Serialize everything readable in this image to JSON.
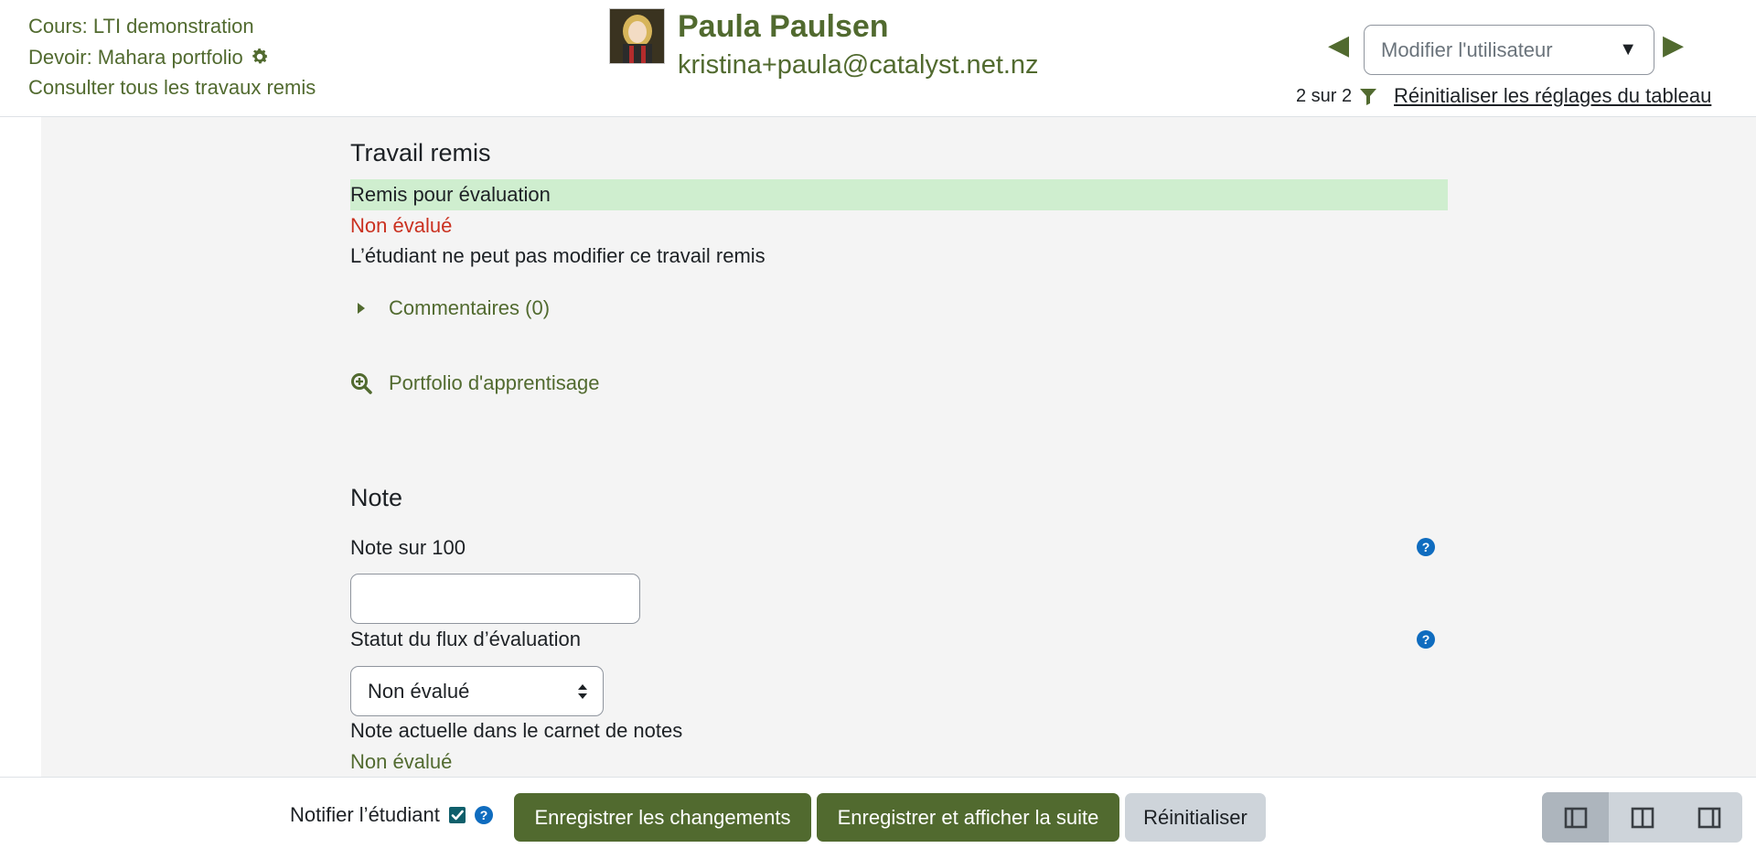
{
  "header": {
    "course": "Cours: LTI demonstration",
    "assignment": "Devoir: Mahara portfolio",
    "view_all": "Consulter tous les travaux remis",
    "user_name": "Paula Paulsen",
    "user_email": "kristina+paula@catalyst.net.nz",
    "change_user_placeholder": "Modifier l'utilisateur",
    "prev_symbol": "◀",
    "next_symbol": "▶",
    "caret_symbol": "▼",
    "count": "2 sur 2",
    "reset_table": "Réinitialiser les réglages du tableau"
  },
  "submission": {
    "heading": "Travail remis",
    "status": "Remis pour évaluation",
    "grading_status": "Non évalué",
    "lock_note": "L’étudiant ne peut pas modifier ce travail remis",
    "comments": "Commentaires (0)",
    "portfolio": "Portfolio d'apprentisage"
  },
  "grade": {
    "heading": "Note",
    "grade_label": "Note sur 100",
    "grade_value": "",
    "workflow_label": "Statut du flux d’évaluation",
    "workflow_value": "Non évalué",
    "current_label": "Note actuelle dans le carnet de notes",
    "current_value": "Non évalué"
  },
  "footer": {
    "notify_label": "Notifier l’étudiant",
    "notify_checked": true,
    "save": "Enregistrer les changements",
    "save_next": "Enregistrer et afficher la suite",
    "reset": "Réinitialiser"
  },
  "colors": {
    "brand": "#516a2f",
    "error": "#ca3120",
    "success_bg": "#cfeecf",
    "help": "#0f6cbf"
  },
  "icons": [
    "gear-icon",
    "filter-icon",
    "caret-right-icon",
    "search-plus-icon",
    "help-icon",
    "checkbox-icon",
    "layout-left-icon",
    "layout-both-icon",
    "layout-right-icon"
  ]
}
